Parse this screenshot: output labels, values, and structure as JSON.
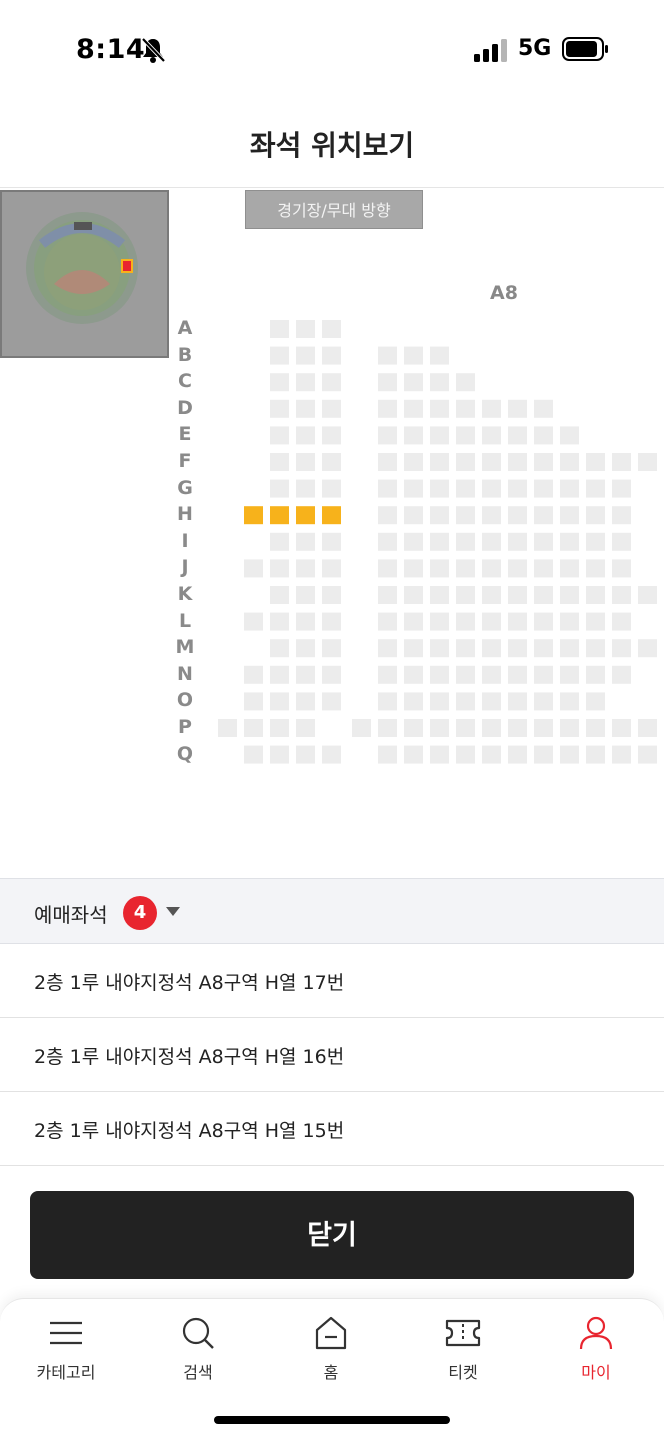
{
  "status_bar": {
    "time": "8:14",
    "network": "5G",
    "icons": [
      "bell-muted-icon",
      "signal-icon",
      "battery-icon"
    ]
  },
  "header": {
    "title": "좌석 위치보기"
  },
  "seat_map": {
    "stage_label": "경기장/무대 방향",
    "section_label": "A8",
    "row_labels": [
      "A",
      "B",
      "C",
      "D",
      "E",
      "F",
      "G",
      "H",
      "I",
      "J",
      "K",
      "L",
      "M",
      "N",
      "O",
      "P",
      "Q"
    ],
    "highlighted_row": "H",
    "highlighted_seat_count": 4,
    "colors": {
      "seat": "#ececec",
      "selected_seat": "#f7b21b",
      "mini_map_marker": "#e8252f"
    }
  },
  "selected_seats": {
    "header_label": "예매좌석",
    "count": "4",
    "items": [
      "2층 1루 내야지정석 A8구역 H열 17번",
      "2층 1루 내야지정석 A8구역 H열 16번",
      "2층 1루 내야지정석 A8구역 H열 15번"
    ]
  },
  "close_button": {
    "label": "닫기"
  },
  "bottom_nav": {
    "items": [
      {
        "label": "카테고리",
        "icon": "menu-icon",
        "active": false
      },
      {
        "label": "검색",
        "icon": "search-icon",
        "active": false
      },
      {
        "label": "홈",
        "icon": "home-icon",
        "active": false
      },
      {
        "label": "티켓",
        "icon": "ticket-icon",
        "active": false
      },
      {
        "label": "마이",
        "icon": "person-icon",
        "active": true
      }
    ],
    "active_color": "#e8252f"
  }
}
